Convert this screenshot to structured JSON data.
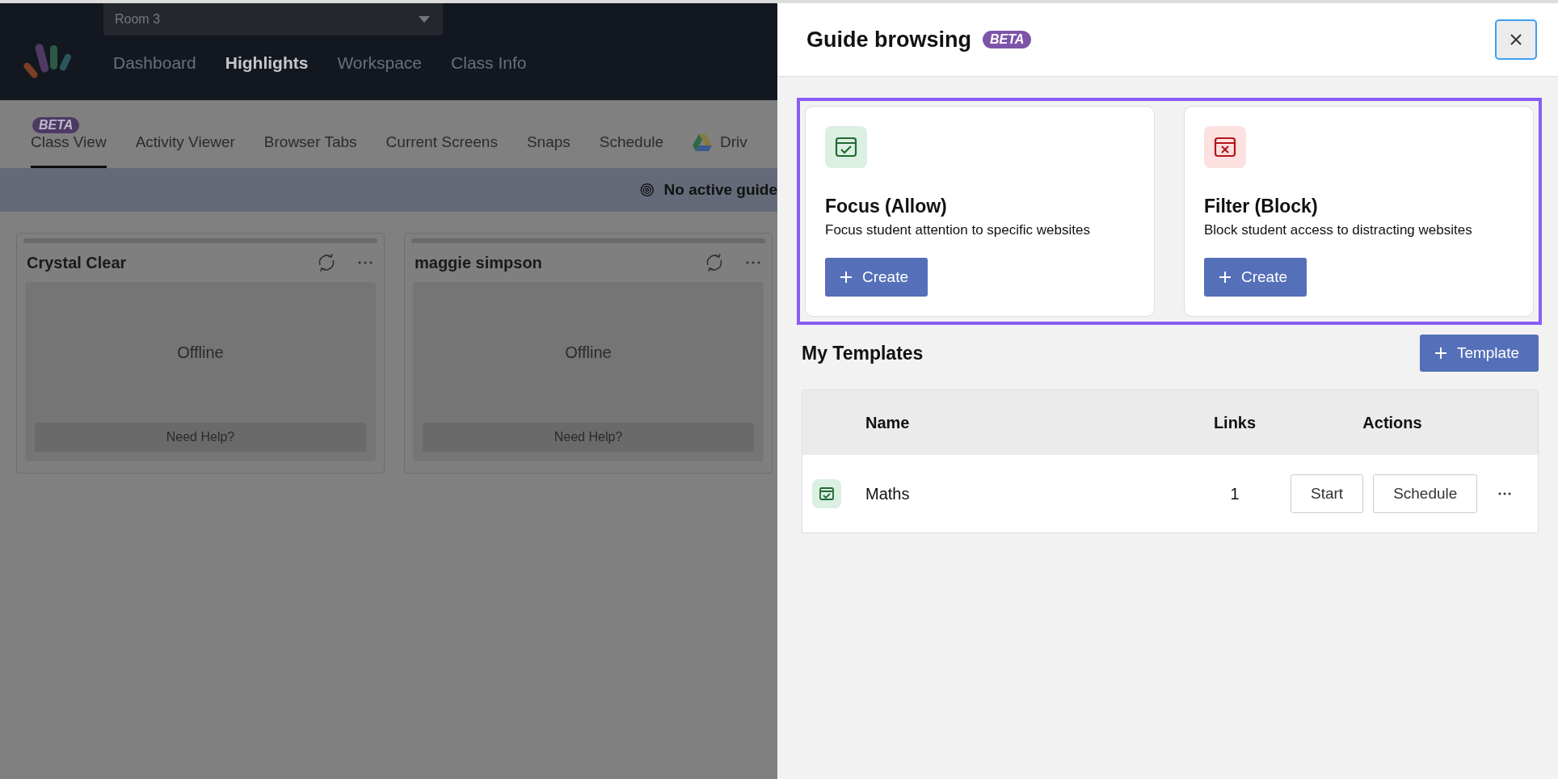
{
  "room_selector": {
    "value": "Room 3"
  },
  "nav": [
    {
      "label": "Dashboard",
      "selected": false
    },
    {
      "label": "Highlights",
      "selected": true
    },
    {
      "label": "Workspace",
      "selected": false
    },
    {
      "label": "Class Info",
      "selected": false
    }
  ],
  "tabs": [
    {
      "label": "Class View",
      "selected": true,
      "badge": "BETA",
      "kind": "text"
    },
    {
      "label": "Activity Viewer",
      "selected": false,
      "kind": "text"
    },
    {
      "label": "Browser Tabs",
      "selected": false,
      "kind": "text"
    },
    {
      "label": "Current Screens",
      "selected": false,
      "kind": "text"
    },
    {
      "label": "Snaps",
      "selected": false,
      "kind": "text"
    },
    {
      "label": "Schedule",
      "selected": false,
      "kind": "text"
    },
    {
      "label": "Driv",
      "selected": false,
      "kind": "drive"
    }
  ],
  "banner": {
    "text": "No active guide"
  },
  "students": [
    {
      "name": "Crystal Clear",
      "status": "Offline",
      "help": "Need Help?"
    },
    {
      "name": "maggie simpson",
      "status": "Offline",
      "help": "Need Help?"
    }
  ],
  "drawer": {
    "title": "Guide browsing",
    "badge": "BETA",
    "options": [
      {
        "kind": "allow",
        "title": "Focus (Allow)",
        "description": "Focus student attention to specific websites",
        "button": "Create"
      },
      {
        "kind": "block",
        "title": "Filter (Block)",
        "description": "Block student access to distracting websites",
        "button": "Create"
      }
    ],
    "templates": {
      "title": "My Templates",
      "button": "Template",
      "columns": [
        "Name",
        "Links",
        "Actions"
      ],
      "rows": [
        {
          "kind": "allow",
          "name": "Maths",
          "links": "1",
          "actions": [
            "Start",
            "Schedule"
          ]
        }
      ]
    }
  }
}
